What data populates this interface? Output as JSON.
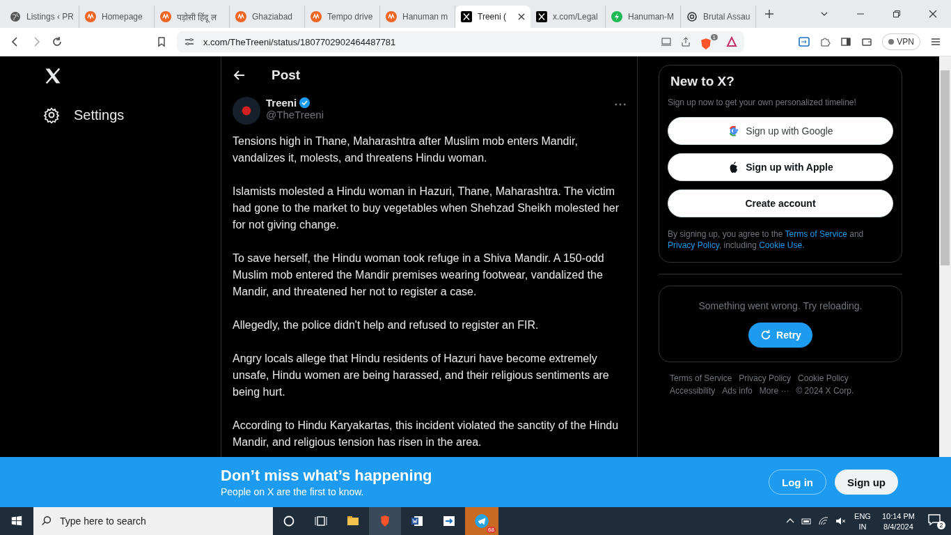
{
  "browser": {
    "tabs": [
      {
        "title": "Listings ‹ PR",
        "kind": "globe",
        "selected": false
      },
      {
        "title": "Homepage",
        "kind": "brand",
        "selected": false
      },
      {
        "title": "पड़ोसी हिंदू ल",
        "kind": "brand",
        "selected": false
      },
      {
        "title": "Ghaziabad",
        "kind": "brand",
        "selected": false
      },
      {
        "title": "Tempo drive",
        "kind": "brand",
        "selected": false
      },
      {
        "title": "Hanuman m",
        "kind": "brand",
        "selected": false
      },
      {
        "title": "Treeni (",
        "kind": "x",
        "selected": true
      },
      {
        "title": "x.com/Legal",
        "kind": "x",
        "selected": false
      },
      {
        "title": "Hanuman-M",
        "kind": "green",
        "selected": false
      },
      {
        "title": "Brutal Assau",
        "kind": "swirl",
        "selected": false
      }
    ],
    "url": "x.com/TheTreeni/status/1807702902464487781",
    "shield_count": "1",
    "vpn": "VPN"
  },
  "sidebar": {
    "settings": "Settings"
  },
  "post": {
    "header": "Post",
    "author": "Treeni",
    "verified": true,
    "handle": "@TheTreeni",
    "paragraphs": [
      "Tensions high in Thane, Maharashtra after Muslim mob enters Mandir, vandalizes it, molests, and threatens Hindu woman.",
      "Islamists molested a Hindu woman in Hazuri, Thane, Maharashtra. The victim had gone to the market to buy vegetables when Shehzad Sheikh molested her for not giving change.",
      "To save herself, the Hindu woman took refuge in a Shiva Mandir. A 150-odd Muslim mob entered the Mandir premises wearing footwear, vandalized the Mandir, and threatened her not to register a case.",
      "Allegedly, the police didn't help and refused to register an FIR.",
      "Angry locals allege that Hindu residents of Hazuri have become extremely unsafe, Hindu women are being harassed, and their religious sentiments are being hurt.",
      "According to Hindu Karyakartas, this incident violated the sanctity of the Hindu Mandir, and religious tension has risen in the area."
    ]
  },
  "signup": {
    "title": "New to X?",
    "subtitle": "Sign up now to get your own personalized timeline!",
    "buttons": [
      {
        "label": "Sign up with Google",
        "kind": "google"
      },
      {
        "label": "Sign up with Apple",
        "kind": "apple"
      },
      {
        "label": "Create account",
        "kind": "plain"
      }
    ],
    "legal": [
      {
        "text": "By signing up, you agree to the ",
        "link": false
      },
      {
        "text": "Terms of Service",
        "link": true
      },
      {
        "text": " and ",
        "link": false
      },
      {
        "text": "Privacy Policy",
        "link": true
      },
      {
        "text": ", including ",
        "link": false
      },
      {
        "text": "Cookie Use.",
        "link": true
      }
    ]
  },
  "error_card": {
    "message": "Something went wrong. Try reloading.",
    "retry": "Retry"
  },
  "footer_links": [
    "Terms of Service",
    "Privacy Policy",
    "Cookie Policy",
    "Accessibility",
    "Ads info",
    "More ···",
    "© 2024 X Corp."
  ],
  "banner": {
    "title": "Don’t miss what’s happening",
    "subtitle": "People on X are the first to know.",
    "login": "Log in",
    "signup": "Sign up"
  },
  "taskbar": {
    "search_placeholder": "Type here to search",
    "telegram_badge": "68",
    "language": "ENG",
    "region": "IN",
    "time": "10:14 PM",
    "date": "8/4/2024",
    "notifications": "2"
  }
}
